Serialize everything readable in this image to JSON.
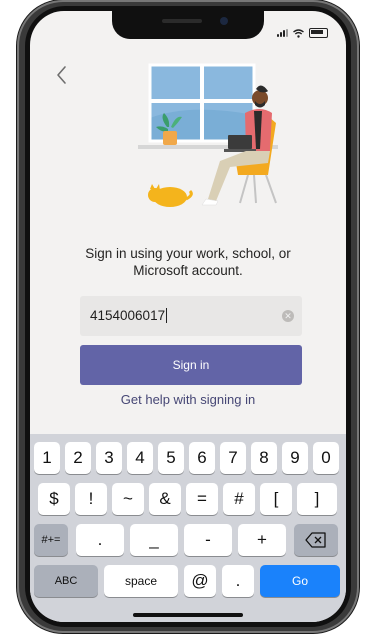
{
  "prompt": {
    "line1": "Sign in using your work, school, or",
    "line2": "Microsoft account."
  },
  "input": {
    "value": "4154006017",
    "clear_icon": "clear-circle-icon"
  },
  "signin_button_label": "Sign in",
  "help_link": "Get help with signing in",
  "keyboard": {
    "number_row": [
      "1",
      "2",
      "3",
      "4",
      "5",
      "6",
      "7",
      "8",
      "9",
      "0"
    ],
    "symbol_row": [
      "$",
      "!",
      "~",
      "&",
      "=",
      "#",
      "[",
      "]"
    ],
    "third_row": {
      "toggle": "#+=",
      "keys": [
        ".",
        "_",
        "-",
        "+"
      ],
      "delete_icon": "backspace-icon"
    },
    "bottom_row": {
      "abc": "ABC",
      "space": "space",
      "at": "@",
      "dot": ".",
      "go": "Go"
    }
  },
  "colors": {
    "accent": "#6264a7",
    "link": "#464775",
    "go_key": "#1a82fb"
  }
}
